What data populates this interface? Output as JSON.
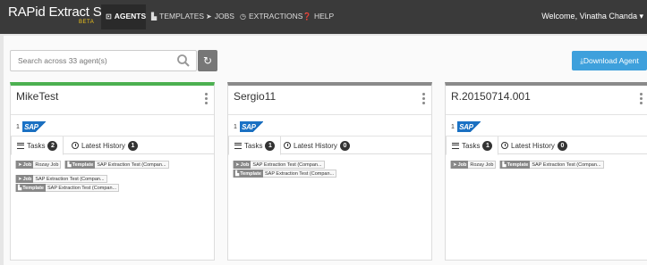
{
  "app": {
    "brand": "RAPid Extract Studio",
    "beta": "BETA",
    "welcome": "Welcome, Vinatha Chanda",
    "colors": {
      "navbar": "#3a3a3a",
      "accent": "#3ea0dc",
      "active_border": "#4cb050",
      "beta": "#f0c419"
    }
  },
  "nav": {
    "agents": "AGENTS",
    "templates": "TEMPLATES",
    "jobs": "JOBS",
    "extractions": "EXTRACTIONS",
    "help": "HELP"
  },
  "toolbar": {
    "search_placeholder": "Search across 33 agent(s)",
    "download_label": "Download Agent"
  },
  "cards": [
    {
      "title": "MikeTest",
      "sap_count": "1",
      "tasks_label": "Tasks",
      "tasks_count": "2",
      "history_label": "Latest History",
      "history_count": "1",
      "rows": [
        [
          {
            "tag": "Job",
            "text": "Rozay Job"
          },
          {
            "tag": "Template",
            "text": "SAP Extraction Test (Compan..."
          }
        ],
        [
          {
            "tag": "Job",
            "text": "SAP Extraction Test (Compan..."
          }
        ],
        [
          {
            "tag": "Template",
            "text": "SAP Extraction Test (Compan..."
          }
        ]
      ]
    },
    {
      "title": "Sergio11",
      "sap_count": "1",
      "tasks_label": "Tasks",
      "tasks_count": "1",
      "history_label": "Latest History",
      "history_count": "0",
      "rows": [
        [
          {
            "tag": "Job",
            "text": "SAP Extraction Test (Compan..."
          }
        ],
        [
          {
            "tag": "Template",
            "text": "SAP Extraction Test (Compan..."
          }
        ]
      ]
    },
    {
      "title": "R.20150714.001",
      "sap_count": "1",
      "tasks_label": "Tasks",
      "tasks_count": "1",
      "history_label": "Latest History",
      "history_count": "0",
      "rows": [
        [
          {
            "tag": "Job",
            "text": "Rozay Job"
          },
          {
            "tag": "Template",
            "text": "SAP Extraction Test (Compan..."
          }
        ]
      ]
    }
  ],
  "sap_logo_text": "SAP"
}
